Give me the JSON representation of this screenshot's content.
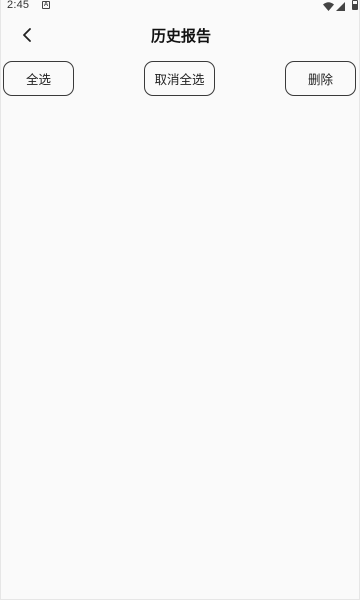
{
  "status_bar": {
    "time": "2:45",
    "notification_icon_letter": "A",
    "icons": [
      "notification-icon",
      "wifi-icon",
      "signal-icon",
      "battery-icon"
    ]
  },
  "header": {
    "title": "历史报告",
    "back_icon": "chevron-left-icon"
  },
  "actions": {
    "select_all_label": "全选",
    "cancel_select_label": "取消全选",
    "delete_label": "删除"
  },
  "colors": {
    "background": "#fafafa",
    "text": "#1a1a1a",
    "button_border": "#3a3a3a"
  }
}
